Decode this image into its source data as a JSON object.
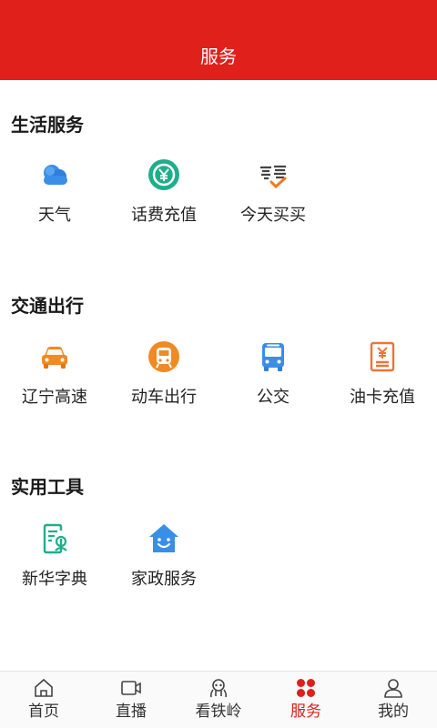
{
  "header": {
    "title": "服务"
  },
  "sections": [
    {
      "title": "生活服务",
      "items": [
        {
          "label": "天气",
          "icon": "cloud-icon"
        },
        {
          "label": "话费充值",
          "icon": "yuan-recharge-icon"
        },
        {
          "label": "今天买买",
          "icon": "shopping-logo-icon"
        }
      ]
    },
    {
      "title": "交通出行",
      "items": [
        {
          "label": "辽宁高速",
          "icon": "car-icon"
        },
        {
          "label": "动车出行",
          "icon": "train-icon"
        },
        {
          "label": "公交",
          "icon": "bus-icon"
        },
        {
          "label": "油卡充值",
          "icon": "fuel-card-icon"
        }
      ]
    },
    {
      "title": "实用工具",
      "items": [
        {
          "label": "新华字典",
          "icon": "dictionary-icon"
        },
        {
          "label": "家政服务",
          "icon": "home-service-icon"
        }
      ]
    }
  ],
  "tabbar": {
    "active": "服务",
    "accent_color": "#e0201b",
    "tabs": [
      {
        "label": "首页",
        "icon": "home-icon"
      },
      {
        "label": "直播",
        "icon": "video-camera-icon"
      },
      {
        "label": "看铁岭",
        "icon": "view-icon"
      },
      {
        "label": "服务",
        "icon": "grid-dots-icon"
      },
      {
        "label": "我的",
        "icon": "user-icon"
      }
    ]
  }
}
